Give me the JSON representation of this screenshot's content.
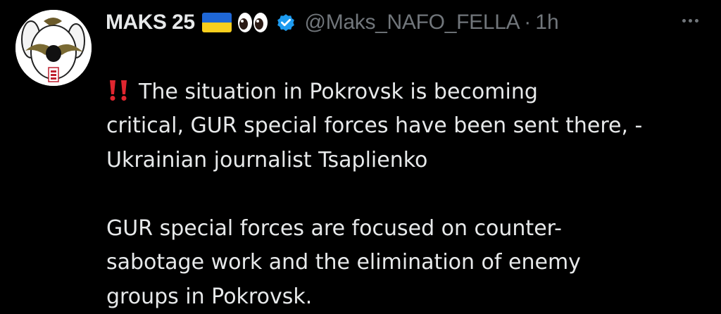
{
  "author": {
    "display_name": "MAKS 25",
    "handle": "@Maks_NAFO_FELLA",
    "separator": "·",
    "time": "1h"
  },
  "icons": {
    "flag": "ukraine-flag-icon",
    "eyes": "eyes-emoji-icon",
    "verified": "verified-badge-icon",
    "alert": "double-exclamation-icon",
    "more": "more-options-icon"
  },
  "colors": {
    "background": "#000000",
    "text": "#e7e9ea",
    "muted": "#71767b",
    "verified_blue": "#1d9bf0",
    "flag_blue": "#1f67d6",
    "flag_yellow": "#f8cf1e",
    "alert_red": "#e0262f"
  },
  "tweet": {
    "paragraph1_lines": [
      "The situation in Pokrovsk is becoming",
      "critical, GUR special forces have been sent there, -",
      "Ukrainian journalist Tsaplienko"
    ],
    "paragraph2_lines": [
      "GUR special forces are focused on counter-",
      "sabotage work and the elimination of enemy",
      "groups in Pokrovsk."
    ]
  }
}
